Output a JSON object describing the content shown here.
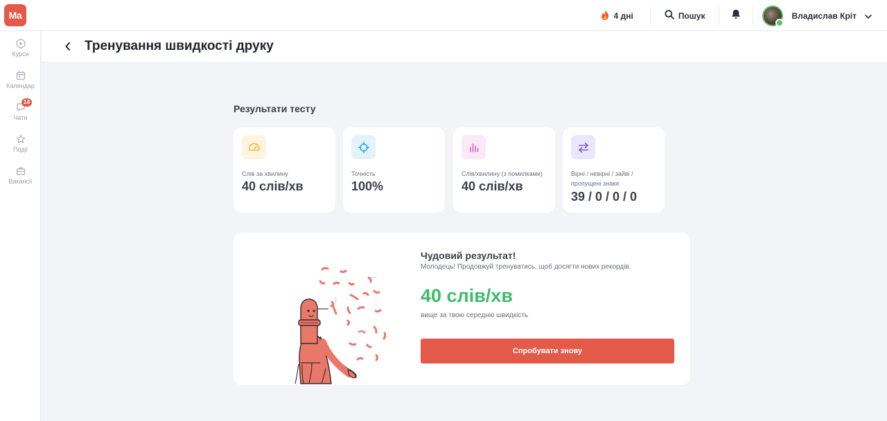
{
  "header": {
    "logo_text": "Ma",
    "streak_text": "4 дні",
    "search_label": "Пошук",
    "user_name": "Владислав Кріт"
  },
  "sidebar": {
    "items": [
      {
        "label": "Курси",
        "icon": "play-circle-icon"
      },
      {
        "label": "Календар",
        "icon": "calendar-icon"
      },
      {
        "label": "Чати",
        "icon": "chat-icon",
        "badge": "14"
      },
      {
        "label": "Події",
        "icon": "star-icon"
      },
      {
        "label": "Вакансії",
        "icon": "briefcase-icon"
      }
    ]
  },
  "page": {
    "title": "Тренування швидкості друку"
  },
  "results": {
    "section_title": "Результати тесту",
    "stats": [
      {
        "label": "Слів за хвилину",
        "value": "40 слів/хв",
        "icon": "speedometer-icon",
        "color": "#f3b93a"
      },
      {
        "label": "Точність",
        "value": "100%",
        "icon": "crosshair-icon",
        "color": "#3aa9e0"
      },
      {
        "label": "Слів/хвилину (з помилками)",
        "value": "40 слів/хв",
        "icon": "bar-chart-icon",
        "color": "#d85fc9"
      },
      {
        "label": "Вірні / невірні / зайві / пропущені знаки",
        "value": "39 / 0 / 0 / 0",
        "icon": "swap-arrows-icon",
        "color": "#7a5bd8"
      }
    ]
  },
  "summary": {
    "title": "Чудовий результат!",
    "subtitle": "Молодець! Продовжуй тренуватись, щоб досягти нових рекордів.",
    "speed": "40 слів/хв",
    "note": "вище за твою середню швидкість",
    "retry_label": "Спробувати знову"
  },
  "colors": {
    "accent": "#e35a4a",
    "success": "#3bbd6a",
    "background": "#f3f4f8"
  }
}
